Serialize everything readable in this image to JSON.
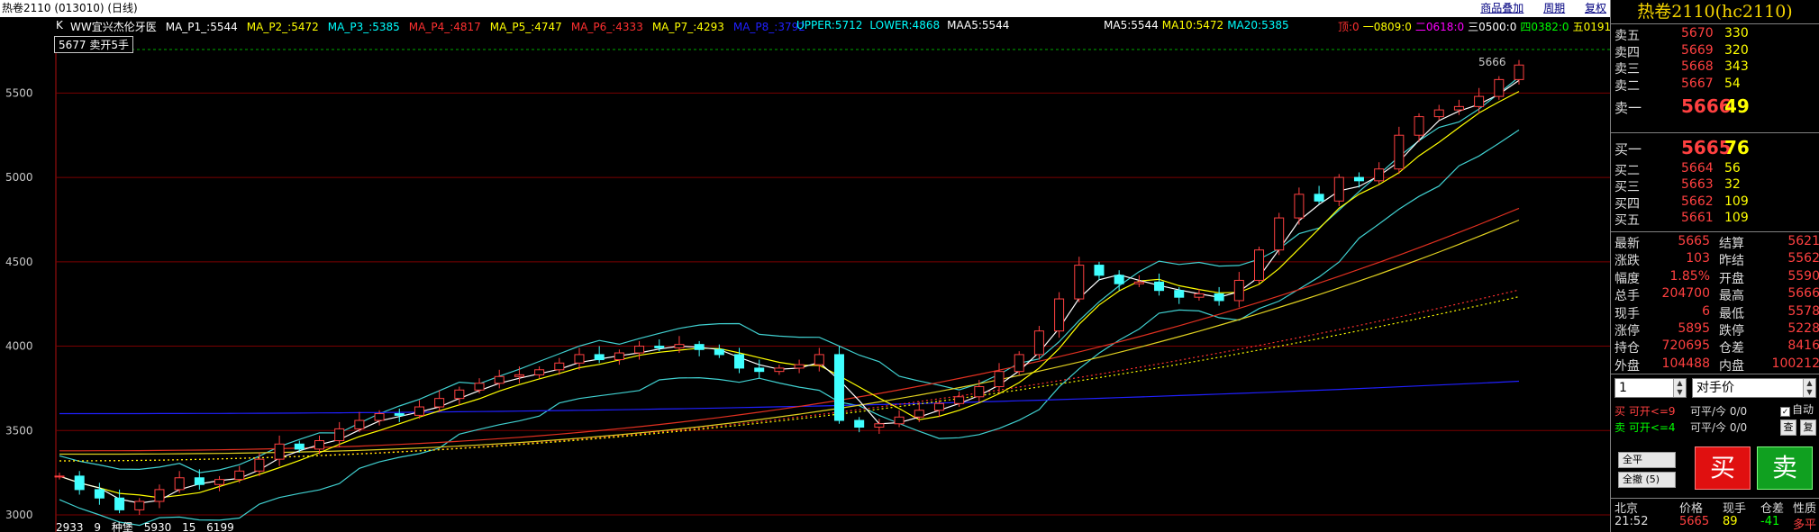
{
  "window": {
    "title": "热卷2110 (013010) (日线)",
    "links": [
      "商品叠加",
      "周期",
      "复权"
    ]
  },
  "indicators": {
    "k_label": "K",
    "ma_line": [
      {
        "text": "WW宜兴杰伦牙医",
        "color": "#ffffff"
      },
      {
        "text": "MA_P1_:5544",
        "color": "#ffffff"
      },
      {
        "text": "MA_P2_:5472",
        "color": "#ffff00"
      },
      {
        "text": "MA_P3_:5385",
        "color": "#00ffff"
      },
      {
        "text": "MA_P4_:4817",
        "color": "#ff3030"
      },
      {
        "text": "MA_P5_:4747",
        "color": "#ffff00"
      },
      {
        "text": "MA_P6_:4333",
        "color": "#ff3030"
      },
      {
        "text": "MA_P7_:4293",
        "color": "#ffff00"
      },
      {
        "text": "MA_P8_:3792",
        "color": "#2020ff"
      }
    ],
    "bands": [
      {
        "text": "UPPER:5712",
        "color": "#00ffff"
      },
      {
        "text": "LOWER:4868",
        "color": "#00ffff"
      },
      {
        "text": "MAA5:5544",
        "color": "#ffffff"
      }
    ],
    "ma_short": [
      {
        "text": "MA5:5544",
        "color": "#ffffff"
      },
      {
        "text": "MA10:5472",
        "color": "#ffff00"
      },
      {
        "text": "MA20:5385",
        "color": "#00ffff"
      }
    ],
    "pivots": [
      {
        "text": "顶:0",
        "color": "#ff3030"
      },
      {
        "text": "一0809:0",
        "color": "#ffff00"
      },
      {
        "text": "二0618:0",
        "color": "#ff00ff"
      },
      {
        "text": "三0500:0",
        "color": "#ffffff"
      },
      {
        "text": "四0382:0",
        "color": "#00ff00"
      },
      {
        "text": "五0191:0",
        "color": "#ffff00"
      }
    ],
    "order_tag": "5677 卖开5手"
  },
  "axis": {
    "y_ticks": [
      "5500",
      "5000",
      "4500",
      "4000",
      "3500",
      "3000"
    ]
  },
  "bottom_info": [
    "2933",
    "9",
    "种堡",
    "5930",
    "15",
    "6199"
  ],
  "chart_data": {
    "type": "candlestick",
    "ylim": [
      2920,
      5790
    ],
    "last_label": "5666",
    "series_names": [
      "MA5",
      "MA10",
      "MA20",
      "UPPER",
      "LOWER"
    ],
    "close_path": [
      3230,
      3150,
      3100,
      3030,
      3080,
      3150,
      3220,
      3180,
      3210,
      3260,
      3330,
      3420,
      3390,
      3440,
      3510,
      3560,
      3600,
      3590,
      3640,
      3690,
      3740,
      3780,
      3820,
      3830,
      3860,
      3900,
      3950,
      3920,
      3960,
      4000,
      3990,
      4010,
      3980,
      3950,
      3870,
      3850,
      3870,
      3890,
      3950,
      3560,
      3520,
      3540,
      3580,
      3620,
      3660,
      3700,
      3760,
      3850,
      3950,
      4090,
      4280,
      4480,
      4420,
      4370,
      4380,
      4330,
      4290,
      4310,
      4270,
      4390,
      4570,
      4760,
      4900,
      4860,
      5000,
      4980,
      5050,
      5250,
      5360,
      5400,
      5420,
      5480,
      5580,
      5666
    ]
  },
  "panel": {
    "title": "热卷2110(hc2110)",
    "asks": [
      {
        "label": "卖五",
        "price": "5670",
        "vol": "330"
      },
      {
        "label": "卖四",
        "price": "5669",
        "vol": "320"
      },
      {
        "label": "卖三",
        "price": "5668",
        "vol": "343"
      },
      {
        "label": "卖二",
        "price": "5667",
        "vol": "54"
      },
      {
        "label": "卖一",
        "price": "5666",
        "vol": "49"
      }
    ],
    "bids": [
      {
        "label": "买一",
        "price": "5665",
        "vol": "76"
      },
      {
        "label": "买二",
        "price": "5664",
        "vol": "56"
      },
      {
        "label": "买三",
        "price": "5663",
        "vol": "32"
      },
      {
        "label": "买四",
        "price": "5662",
        "vol": "109"
      },
      {
        "label": "买五",
        "price": "5661",
        "vol": "109"
      }
    ],
    "stats": [
      {
        "l1": "最新",
        "v1": "5665",
        "l2": "结算",
        "v2": "5621"
      },
      {
        "l1": "涨跌",
        "v1": "103",
        "l2": "昨结",
        "v2": "5562"
      },
      {
        "l1": "幅度",
        "v1": "1.85%",
        "l2": "开盘",
        "v2": "5590"
      },
      {
        "l1": "总手",
        "v1": "204700",
        "l2": "最高",
        "v2": "5666"
      },
      {
        "l1": "现手",
        "v1": "6",
        "l2": "最低",
        "v2": "5578"
      },
      {
        "l1": "涨停",
        "v1": "5895",
        "l2": "跌停",
        "v2": "5228"
      },
      {
        "l1": "持仓",
        "v1": "720695",
        "l2": "仓差",
        "v2": "8416"
      },
      {
        "l1": "外盘",
        "v1": "104488",
        "l2": "内盘",
        "v2": "100212"
      }
    ],
    "trade": {
      "qty": "1",
      "price_type": "对手价",
      "buy_line": "买 可开<=9",
      "sell_line": "卖 可开<=4",
      "buy_close": "可平/今 0/0",
      "sell_close": "可平/今 0/0",
      "auto_label": "自动",
      "btn_query": "查",
      "btn_reset": "复",
      "btn_close_all": "全平",
      "btn_cancel_all": "全撤 (5)",
      "btn_buy": "买",
      "btn_sell": "卖"
    },
    "tick_header": [
      "北京",
      "价格",
      "现手",
      "仓差",
      "性质"
    ],
    "tick_row": [
      "21:52",
      "5665",
      "89",
      "-41",
      "多平"
    ]
  }
}
